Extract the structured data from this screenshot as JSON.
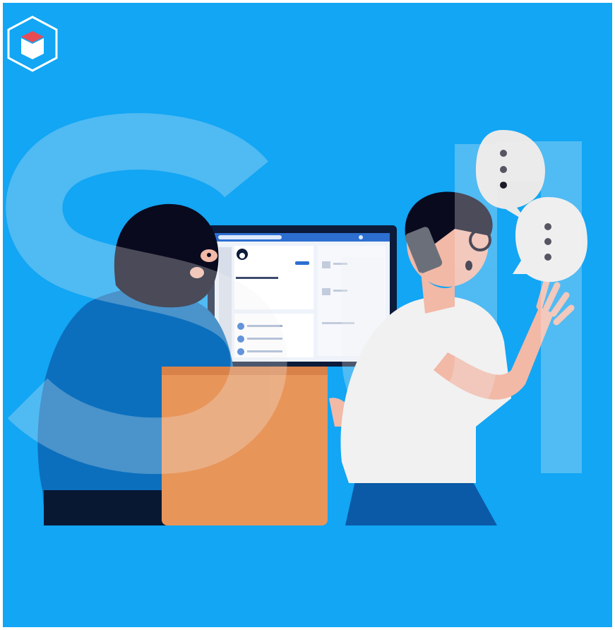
{
  "colors": {
    "background": "#12a6f4",
    "skin": "#f2b9a7",
    "hoodie": "#0b6fbd",
    "mask": "#0a0a1f",
    "desk": "#e8955a",
    "shirt": "#f1f1f1",
    "jeans": "#0a5aa8",
    "screen_frame": "#0c1b3a",
    "watermark": "#f2f2f2"
  },
  "icons": {
    "logo": "cube-logo-icon",
    "bubble_1": "speech-bubble-icon",
    "bubble_2": "speech-bubble-icon",
    "phone": "phone-icon"
  }
}
